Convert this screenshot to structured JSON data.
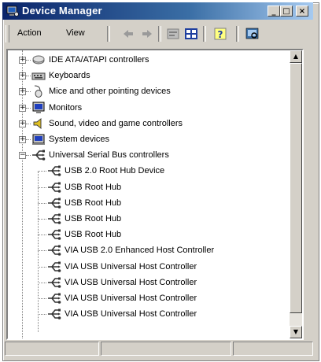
{
  "window": {
    "title": "Device Manager"
  },
  "title_buttons": {
    "minimize": "_",
    "maximize": "□",
    "close": "×"
  },
  "menu": {
    "action": "Action",
    "view": "View"
  },
  "toolbar": {
    "tools": [
      "back-arrow-icon",
      "forward-arrow-icon",
      "properties-icon",
      "computer-view-icon",
      "help-icon",
      "scan-hardware-icon"
    ]
  },
  "tree": {
    "categories": [
      {
        "label": "IDE ATA/ATAPI controllers",
        "icon": "ide-controller-icon",
        "expander": "+"
      },
      {
        "label": "Keyboards",
        "icon": "keyboard-icon",
        "expander": "+"
      },
      {
        "label": "Mice and other pointing devices",
        "icon": "mouse-icon",
        "expander": "+"
      },
      {
        "label": "Monitors",
        "icon": "monitor-icon",
        "expander": "+"
      },
      {
        "label": "Sound, video and game controllers",
        "icon": "sound-icon",
        "expander": "+"
      },
      {
        "label": "System devices",
        "icon": "system-icon",
        "expander": "+"
      },
      {
        "label": "Universal Serial Bus controllers",
        "icon": "usb-icon",
        "expander": "−"
      }
    ],
    "usb_children": [
      "USB 2.0 Root Hub Device",
      "USB Root Hub",
      "USB Root Hub",
      "USB Root Hub",
      "USB Root Hub",
      "VIA USB 2.0 Enhanced Host Controller",
      "VIA USB Universal Host Controller",
      "VIA USB Universal Host Controller",
      "VIA USB Universal Host Controller",
      "VIA USB Universal Host Controller"
    ]
  },
  "scrollbar": {
    "up": "▲",
    "down": "▼"
  },
  "colors": {
    "titlebar_start": "#0a246a",
    "titlebar_end": "#a6caf0",
    "face": "#d4d0c8",
    "usb_icon": "#333333"
  }
}
